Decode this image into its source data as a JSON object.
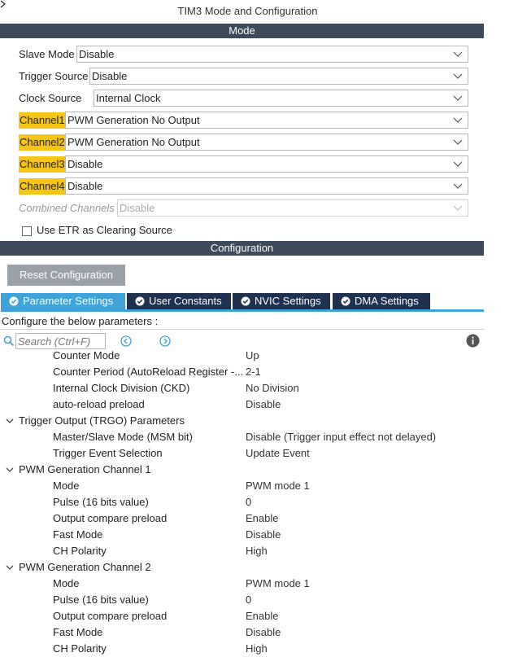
{
  "window": {
    "title": "TIM3 Mode and Configuration"
  },
  "mode_section": {
    "title": "Mode"
  },
  "mode_fields": [
    {
      "label": "Slave Mode",
      "value": "Disable",
      "highlight": false,
      "disabled": false
    },
    {
      "label": "Trigger Source",
      "value": "Disable",
      "highlight": false,
      "disabled": false
    },
    {
      "label": "Clock Source",
      "value": "Internal Clock",
      "highlight": false,
      "disabled": false
    },
    {
      "label": "Channel1",
      "value": "PWM Generation No Output",
      "highlight": true,
      "disabled": false
    },
    {
      "label": "Channel2",
      "value": "PWM Generation No Output",
      "highlight": true,
      "disabled": false
    },
    {
      "label": "Channel3",
      "value": "Disable",
      "highlight": true,
      "disabled": false
    },
    {
      "label": "Channel4",
      "value": "Disable",
      "highlight": true,
      "disabled": false
    },
    {
      "label": "Combined Channels",
      "value": "Disable",
      "highlight": false,
      "disabled": true
    }
  ],
  "etr_checkbox": {
    "label": "Use ETR as Clearing Source",
    "checked": false
  },
  "config_section": {
    "title": "Configuration"
  },
  "reset_button": {
    "label": "Reset Configuration"
  },
  "tabs": [
    {
      "label": "Parameter Settings",
      "active": true
    },
    {
      "label": "User Constants",
      "active": false
    },
    {
      "label": "NVIC Settings",
      "active": false
    },
    {
      "label": "DMA Settings",
      "active": false
    }
  ],
  "configure_text": "Configure the below parameters :",
  "search": {
    "placeholder": "Search (Ctrl+F)"
  },
  "params": [
    {
      "type": "param",
      "name": "Counter Mode",
      "value": "Up"
    },
    {
      "type": "param",
      "name": "Counter Period (AutoReload Register -...",
      "value": "2-1"
    },
    {
      "type": "param",
      "name": "Internal Clock Division (CKD)",
      "value": "No Division"
    },
    {
      "type": "param",
      "name": "auto-reload preload",
      "value": "Disable"
    },
    {
      "type": "group",
      "name": "Trigger Output (TRGO) Parameters",
      "value": ""
    },
    {
      "type": "param",
      "name": "Master/Slave Mode (MSM bit)",
      "value": "Disable (Trigger input effect not delayed)"
    },
    {
      "type": "param",
      "name": "Trigger Event Selection",
      "value": "Update Event"
    },
    {
      "type": "group",
      "name": "PWM Generation Channel 1",
      "value": ""
    },
    {
      "type": "param",
      "name": "Mode",
      "value": "PWM mode 1"
    },
    {
      "type": "param",
      "name": "Pulse (16 bits value)",
      "value": "0"
    },
    {
      "type": "param",
      "name": "Output compare preload",
      "value": "Enable"
    },
    {
      "type": "param",
      "name": "Fast Mode",
      "value": "Disable"
    },
    {
      "type": "param",
      "name": "CH Polarity",
      "value": "High"
    },
    {
      "type": "group",
      "name": "PWM Generation Channel 2",
      "value": ""
    },
    {
      "type": "param",
      "name": "Mode",
      "value": "PWM mode 1"
    },
    {
      "type": "param",
      "name": "Pulse (16 bits value)",
      "value": "0"
    },
    {
      "type": "param",
      "name": "Output compare preload",
      "value": "Enable"
    },
    {
      "type": "param",
      "name": "Fast Mode",
      "value": "Disable"
    },
    {
      "type": "param",
      "name": "CH Polarity",
      "value": "High"
    }
  ],
  "icons": {
    "tab_check": "check-circle-icon",
    "search_prev": "circle-chevron-left-icon",
    "search_next": "circle-chevron-right-icon",
    "info": "info-icon",
    "dropdown": "chevron-down-icon",
    "group_toggle": "chevron-down-icon"
  },
  "colors": {
    "section_bar": "#3c4a5c",
    "tab_active": "#3da3d8",
    "tab_inactive": "#1f3050",
    "highlight": "#f5c518",
    "reset_button": "#9aa1a8"
  }
}
